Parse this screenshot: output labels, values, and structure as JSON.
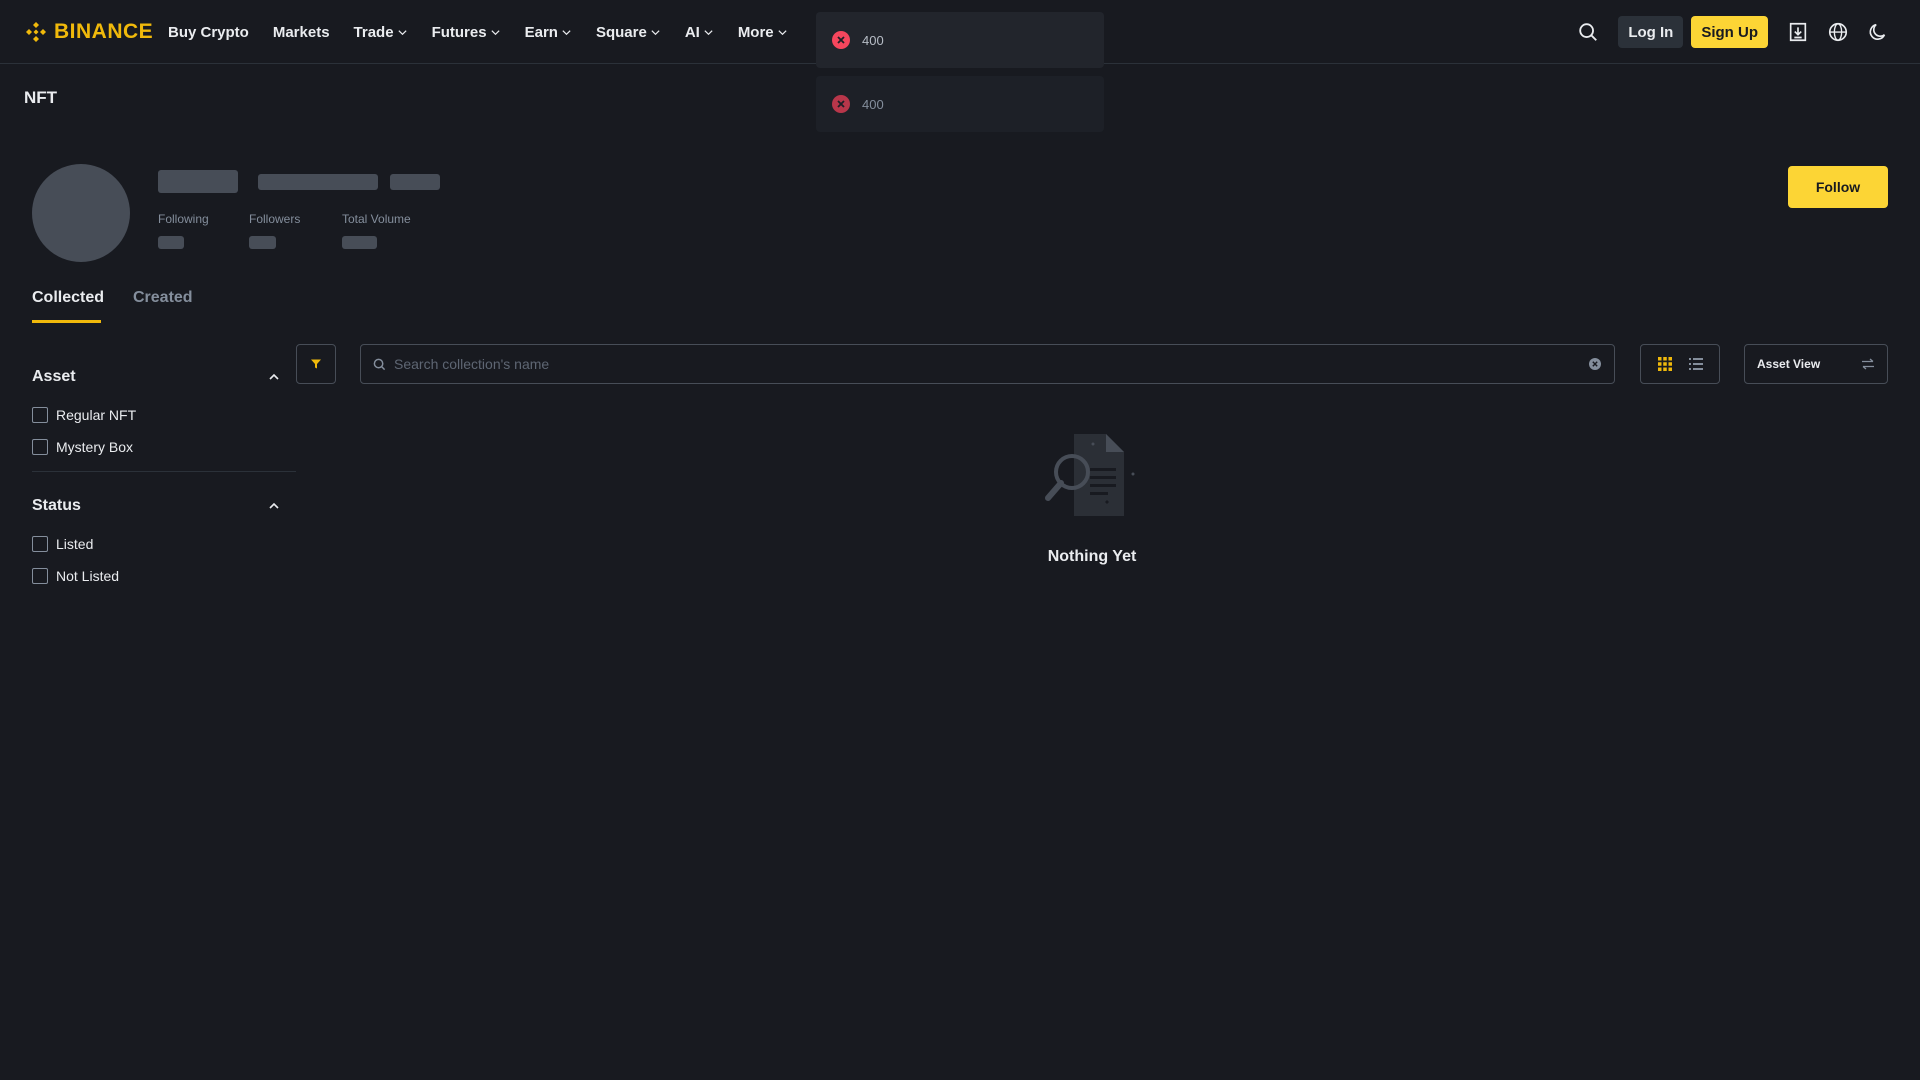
{
  "header": {
    "logo_text": "BINANCE",
    "nav": [
      {
        "label": "Buy Crypto",
        "dropdown": false
      },
      {
        "label": "Markets",
        "dropdown": false
      },
      {
        "label": "Trade",
        "dropdown": true
      },
      {
        "label": "Futures",
        "dropdown": true
      },
      {
        "label": "Earn",
        "dropdown": true
      },
      {
        "label": "Square",
        "dropdown": true
      },
      {
        "label": "AI",
        "dropdown": true
      },
      {
        "label": "More",
        "dropdown": true
      }
    ],
    "login_label": "Log In",
    "signup_label": "Sign Up"
  },
  "toasts": [
    {
      "message": "400"
    },
    {
      "message": "400"
    }
  ],
  "page": {
    "label": "NFT"
  },
  "profile": {
    "stats": {
      "following_label": "Following",
      "followers_label": "Followers",
      "volume_label": "Total Volume"
    },
    "follow_label": "Follow"
  },
  "tabs": [
    {
      "label": "Collected",
      "active": true
    },
    {
      "label": "Created",
      "active": false
    }
  ],
  "filters": {
    "asset": {
      "title": "Asset",
      "options": [
        "Regular NFT",
        "Mystery Box"
      ]
    },
    "status": {
      "title": "Status",
      "options": [
        "Listed",
        "Not Listed"
      ]
    }
  },
  "toolbar": {
    "search_placeholder": "Search collection's name",
    "asset_view_label": "Asset View"
  },
  "empty_state": {
    "message": "Nothing Yet"
  },
  "colors": {
    "background": "#181a20",
    "accent": "#fcd535",
    "brand": "#f0b90b",
    "error": "#f6465d",
    "skeleton": "#474d57"
  }
}
